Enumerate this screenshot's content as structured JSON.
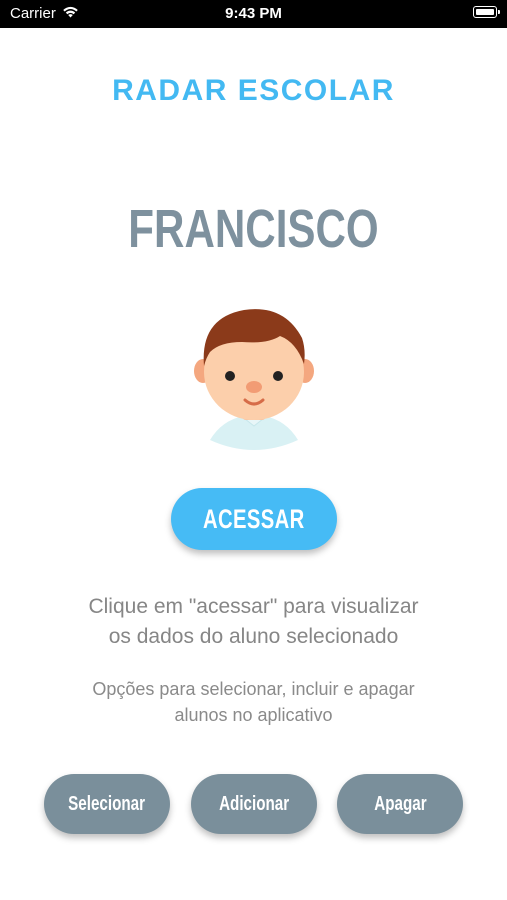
{
  "status_bar": {
    "carrier": "Carrier",
    "time": "9:43 PM",
    "wifi_icon": "wifi-icon",
    "battery_icon": "battery-icon"
  },
  "app": {
    "title": "RADAR ESCOLAR",
    "accent_color": "#43b9f2"
  },
  "student": {
    "name": "FRANCISCO",
    "avatar_icon": "boy-avatar-icon"
  },
  "access_button": {
    "label": "ACESSAR"
  },
  "hints": {
    "primary_line1": "Clique em \"acessar\" para visualizar",
    "primary_line2": "os dados do aluno selecionado",
    "secondary_line1": "Opções para selecionar, incluir e apagar",
    "secondary_line2": "alunos no aplicativo"
  },
  "options": [
    {
      "label": "Selecionar"
    },
    {
      "label": "Adicionar"
    },
    {
      "label": "Apagar"
    }
  ],
  "colors": {
    "primary_button": "#46bbf5",
    "secondary_button": "#7a8f9b",
    "name_text": "#7e919e"
  }
}
